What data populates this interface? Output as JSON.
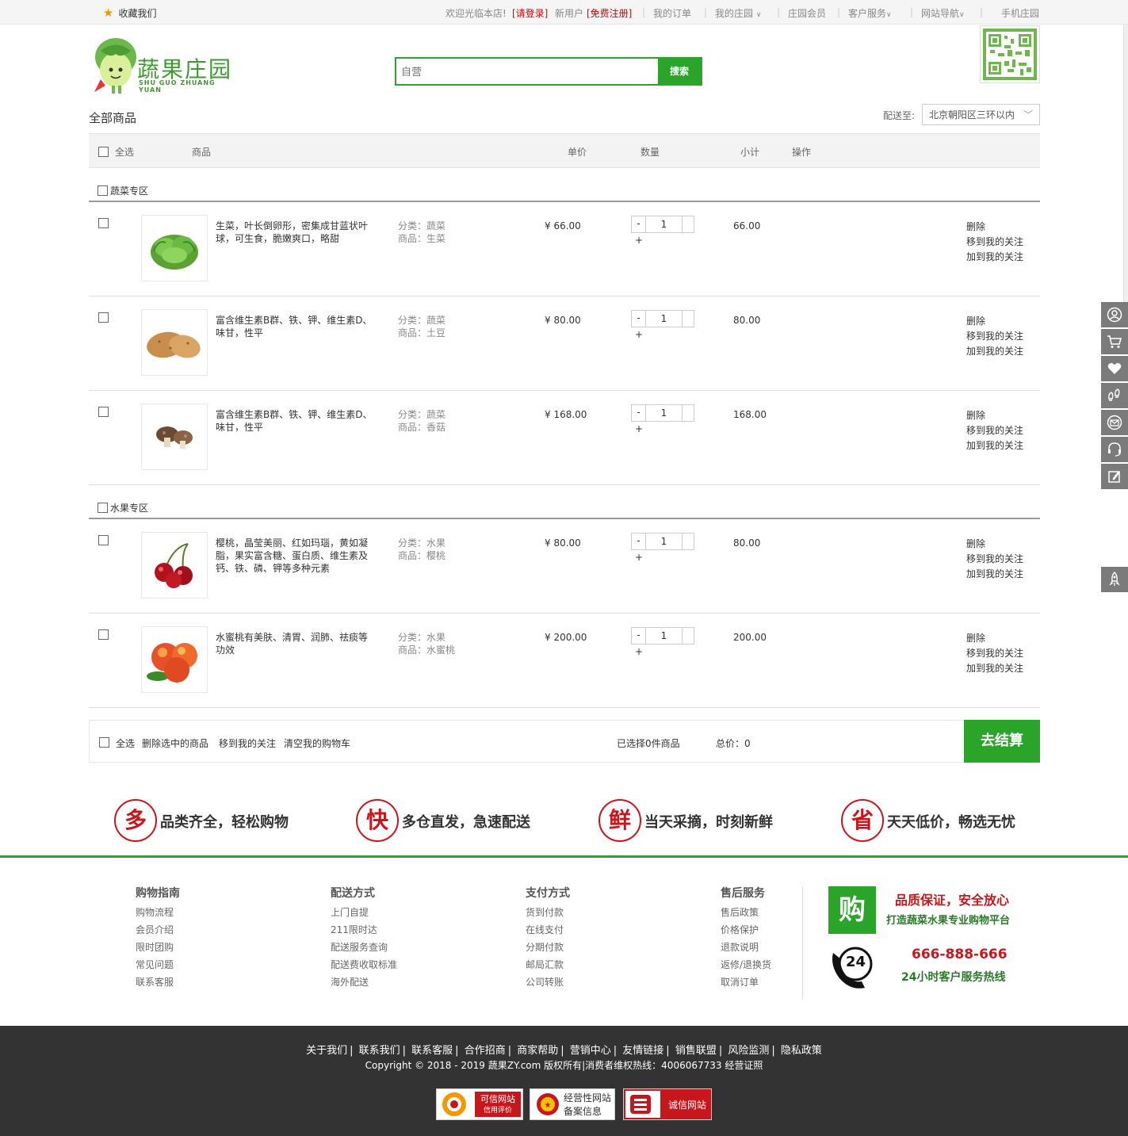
{
  "topbar": {
    "favorite": "收藏我们",
    "welcome": "欢迎光临本店!",
    "login": "[请登录]",
    "new_user": "新用户",
    "register": "[免费注册]",
    "my_orders": "我的订单",
    "my_manor": "我的庄园",
    "member": "庄园会员",
    "service": "客户服务",
    "site_nav": "网站导航",
    "mobile": "手机庄园"
  },
  "search": {
    "placeholder": "自营",
    "button": "搜索"
  },
  "cart": {
    "title": "全部商品",
    "deliver_label": "配送至:",
    "deliver_value": "北京朝阳区三环以内",
    "headers": {
      "select_all": "全选",
      "product": "商品",
      "unit_price": "单价",
      "quantity": "数量",
      "subtotal": "小计",
      "action": "操作"
    },
    "sections": [
      {
        "title": "蔬菜专区",
        "items": [
          {
            "desc": "生菜，叶长倒卵形，密集成甘蓝状叶球，可生食，脆嫩爽口，略甜",
            "category": "分类：蔬菜",
            "name": "商品：生菜",
            "price": "¥ 66.00",
            "qty": "1",
            "subtotal": "66.00",
            "image": "lettuce"
          },
          {
            "desc": "富含维生素B群、铁、钾、维生素D、味甘，性平",
            "category": "分类：蔬菜",
            "name": "商品：土豆",
            "price": "¥ 80.00",
            "qty": "1",
            "subtotal": "80.00",
            "image": "potato"
          },
          {
            "desc": "富含维生素B群、铁、钾、维生素D、味甘，性平",
            "category": "分类：蔬菜",
            "name": "商品：香菇",
            "price": "¥ 168.00",
            "qty": "1",
            "subtotal": "168.00",
            "image": "mushroom"
          }
        ]
      },
      {
        "title": "水果专区",
        "items": [
          {
            "desc": "樱桃，晶莹美丽、红如玛瑙，黄如凝脂，果实富含糖、蛋白质、维生素及钙、铁、磷、钾等多种元素",
            "category": "分类：水果",
            "name": "商品：樱桃",
            "price": "¥ 80.00",
            "qty": "1",
            "subtotal": "80.00",
            "image": "cherry"
          },
          {
            "desc": "水蜜桃有美肤、清胃、润肺、祛痰等功效",
            "category": "分类：水果",
            "name": "商品：水蜜桃",
            "price": "¥ 200.00",
            "qty": "1",
            "subtotal": "200.00",
            "image": "peach"
          }
        ]
      }
    ],
    "row_actions": {
      "minus": "-",
      "plus": "+",
      "delete": "删除",
      "move1": "移到我的关注",
      "move2": "加到我的关注"
    },
    "bottom": {
      "select_all": "全选",
      "delete_selected": "删除选中的商品",
      "move_follow": "移到我的关注",
      "clear": "清空我的购物车",
      "selected_count": "已选择0件商品",
      "total_label": "总价：",
      "total_value": "0",
      "checkout": "去结算"
    }
  },
  "features": [
    {
      "char": "多",
      "text": "品类齐全，轻松购物"
    },
    {
      "char": "快",
      "text": "多仓直发，急速配送"
    },
    {
      "char": "鲜",
      "text": "当天采摘，时刻新鲜"
    },
    {
      "char": "省",
      "text": "天天低价，畅选无忧"
    }
  ],
  "footer_cols": [
    {
      "title": "购物指南",
      "links": [
        "购物流程",
        "会员介绍",
        "限时团购",
        "常见问题",
        "联系客服"
      ]
    },
    {
      "title": "配送方式",
      "links": [
        "上门自提",
        "211限时达",
        "配送服务查询",
        "配送费收取标准",
        "海外配送"
      ]
    },
    {
      "title": "支付方式",
      "links": [
        "货到付款",
        "在线支付",
        "分期付款",
        "邮局汇款",
        "公司转账"
      ]
    },
    {
      "title": "售后服务",
      "links": [
        "售后政策",
        "价格保护",
        "退款说明",
        "返修/退换货",
        "取消订单"
      ]
    }
  ],
  "promise": {
    "buy_char": "购",
    "line1": "品质保证，安全放心",
    "line2": "打造蔬菜水果专业购物平台",
    "tel_badge": "24",
    "phone": "666-888-666",
    "line3": "24小时客户服务热线"
  },
  "bottom_links": [
    "关于我们",
    "联系我们",
    "联系客服",
    "合作招商",
    "商家帮助",
    "营销中心",
    "友情链接",
    "销售联盟",
    "风险监测",
    "隐私政策"
  ],
  "copyright": "Copyright  ©  2018  -  2019  蔬果ZY.com  版权所有|消费者维权热线：4006067733  经营证照",
  "badges": [
    {
      "line1": "可信网站",
      "line2": "信用评价"
    },
    {
      "line1": "经营性网站",
      "line2": "备案信息"
    },
    {
      "line1": "诚信网站"
    }
  ],
  "logo": {
    "cn": "蔬果庄园",
    "en": "SHU GUO ZHUANG YUAN"
  },
  "colors": {
    "green": "#2aa52a",
    "red": "#c8161d",
    "dark": "#333333"
  }
}
